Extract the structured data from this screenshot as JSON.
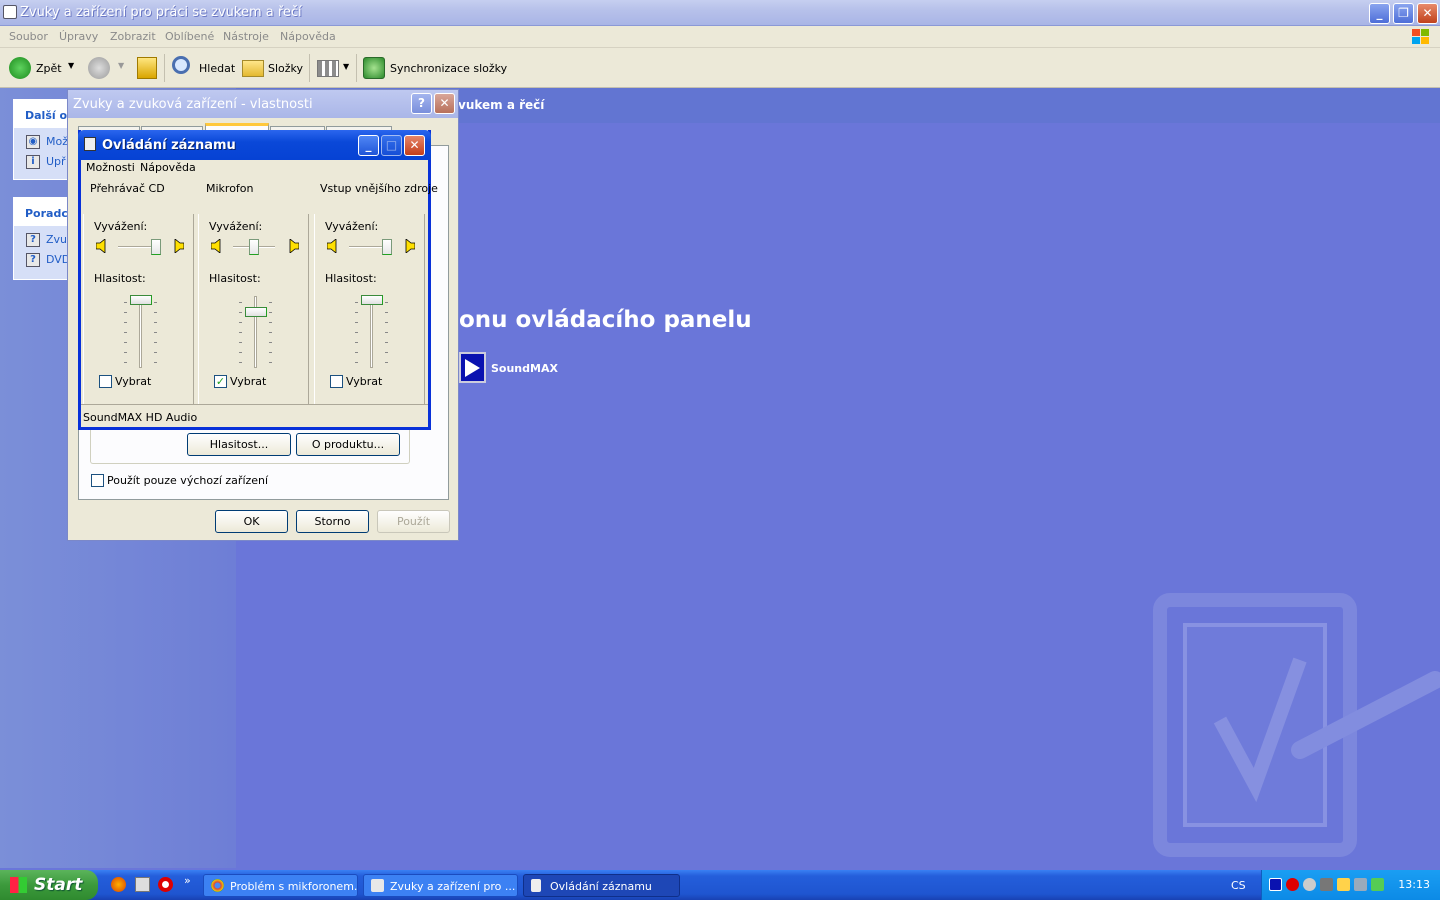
{
  "main_window": {
    "title": "Zvuky a zařízení pro práci se zvukem a řečí",
    "menu": [
      "Soubor",
      "Úpravy",
      "Zobrazit",
      "Oblíbené",
      "Nástroje",
      "Nápověda"
    ],
    "toolbar": {
      "back": "Zpět",
      "search": "Hledat",
      "folders": "Složky",
      "sync": "Synchronizace složky"
    }
  },
  "task_pane": {
    "section1_title": "Další oc",
    "section1_items": [
      "Mož",
      "Upř"
    ],
    "section2_title": "Poradc",
    "section2_items": [
      "Zvu",
      "DVD"
    ]
  },
  "content": {
    "banner_title": "vukem a řečí",
    "heading": "onu ovládacího panelu",
    "icon_label": "SoundMAX"
  },
  "props_dialog": {
    "title": "Zvuky a zvuková zařízení - vlastnosti",
    "volume_button": "Hlasitost...",
    "about_button": "O produktu...",
    "default_only_checkbox": "Použít pouze výchozí zařízení",
    "ok": "OK",
    "cancel": "Storno",
    "apply": "Použít"
  },
  "record_control": {
    "title": "Ovládání záznamu",
    "menu": [
      "Možnosti",
      "Nápověda"
    ],
    "balance_label": "Vyvážení:",
    "volume_label": "Hlasitost:",
    "select_label": "Vybrat",
    "channels": [
      {
        "name": "Přehrávač CD",
        "balance": 0.9,
        "volume": 1.0,
        "selected": false
      },
      {
        "name": "Mikrofon",
        "balance": 0.5,
        "volume": 0.8,
        "selected": true
      },
      {
        "name": "Vstup vnějšího zdroje",
        "balance": 0.9,
        "volume": 1.0,
        "selected": false
      }
    ],
    "status": "SoundMAX HD Audio"
  },
  "taskbar": {
    "start": "Start",
    "tasks": [
      "Problém s mikforonem...",
      "Zvuky a zařízení pro ...",
      "Ovládání záznamu"
    ],
    "language": "CS",
    "clock": "13:13"
  },
  "colors": {
    "desktop": "#6a76d9",
    "xp_blue": "#0831d9",
    "check_green": "#21a121"
  }
}
